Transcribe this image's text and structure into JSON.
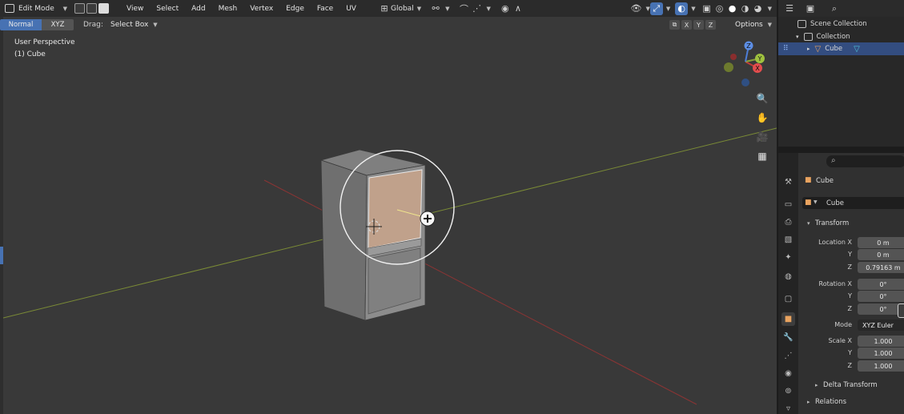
{
  "header": {
    "mode": "Edit Mode",
    "menus": [
      "View",
      "Select",
      "Add",
      "Mesh",
      "Vertex",
      "Edge",
      "Face",
      "UV"
    ],
    "orientation": "Global"
  },
  "tool_header": {
    "orientation_normal": "Normal",
    "orientation_xyz": "XYZ",
    "drag_label": "Drag:",
    "drag_value": "Select Box",
    "axis_x": "X",
    "axis_y": "Y",
    "axis_z": "Z",
    "options": "Options"
  },
  "viewport": {
    "perspective": "User Perspective",
    "object": "(1) Cube"
  },
  "gizmo": {
    "x": "X",
    "y": "Y",
    "z": "Z"
  },
  "outliner": {
    "scene_collection": "Scene Collection",
    "collection": "Collection",
    "object": "Cube"
  },
  "properties": {
    "object_name": "Cube",
    "mesh_name": "Cube",
    "transform_label": "Transform",
    "location_x_label": "Location X",
    "location_x": "0 m",
    "location_y_label": "Y",
    "location_y": "0 m",
    "location_z_label": "Z",
    "location_z": "0.79163 m",
    "rotation_x_label": "Rotation X",
    "rotation_x": "0°",
    "rotation_y_label": "Y",
    "rotation_y": "0°",
    "rotation_z_label": "Z",
    "rotation_z": "0°",
    "mode_label": "Mode",
    "mode_value": "XYZ Euler",
    "scale_x_label": "Scale X",
    "scale_x": "1.000",
    "scale_y_label": "Y",
    "scale_y": "1.000",
    "scale_z_label": "Z",
    "scale_z": "1.000",
    "delta_transform": "Delta Transform",
    "relations": "Relations"
  },
  "colors": {
    "accent": "#4772b3",
    "selected_face": "#c9a48b",
    "x_axis": "#c23a3a",
    "y_axis": "#8ba03a",
    "z_axis": "#4d7dd6"
  }
}
